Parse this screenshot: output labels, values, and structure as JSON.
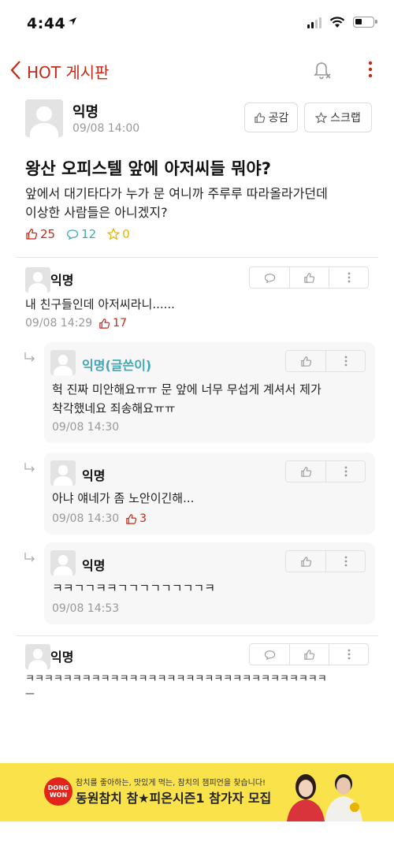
{
  "status_bar": {
    "time": "4:44"
  },
  "header": {
    "title": "HOT 게시판"
  },
  "post": {
    "author": "익명",
    "time": "09/08 14:00",
    "like_button": "공감",
    "scrap_button": "스크랩",
    "title": "왕산 오피스텔 앞에 아저씨들 뭐야?",
    "body_line1": "앞에서 대기타다가 누가 문 여니까 주루루 따라올라가던데",
    "body_line2": "이상한 사람들은 아니겠지?",
    "likes": "25",
    "comments": "12",
    "scraps": "0"
  },
  "comments": [
    {
      "author": "익명",
      "text": "내 친구들인데 아저씨라니......",
      "time": "09/08 14:29",
      "likes": "17"
    },
    {
      "author": "익명",
      "text": "ㅋㅋㅋㅋㅋㅋㅋㅋㅋㅋㅋㅋㅋㅋㅋㅋㅋㅋㅋㅋㅋㅋㅋㅋㅋㅋㅋㅋㅋㅋㅋㅋ",
      "text2": "ㅡ"
    }
  ],
  "replies": [
    {
      "author": "익명(글쓴이)",
      "text1": "헉 진짜 미안해요ㅠㅠ 문 앞에 너무 무섭게 계셔서 제가",
      "text2": "착각했네요 죄송해요ㅠㅠ",
      "time": "09/08 14:30"
    },
    {
      "author": "익명",
      "text": "아냐 얘네가 좀 노안이긴해...",
      "time": "09/08 14:30",
      "likes": "3"
    },
    {
      "author": "익명",
      "text": "ㅋㅋㄱㄱㅋㅋㄱㄱㄱㄱㄱㄱㄱㄱㅋ",
      "time": "09/08 14:53"
    }
  ],
  "ad": {
    "logo": "DONG WON",
    "line1": "참치를 좋아하는, 맛있게 먹는, 참치의 챔피언을 찾습니다!",
    "line2": "동원참치 참★피온시즌1 참가자 모집"
  },
  "colors": {
    "accent": "#c62917",
    "op_author": "#3fa7b7",
    "comment_count": "#3fa7b7",
    "scrap_count": "#e8b400",
    "ad_bg": "#f9e24a"
  }
}
